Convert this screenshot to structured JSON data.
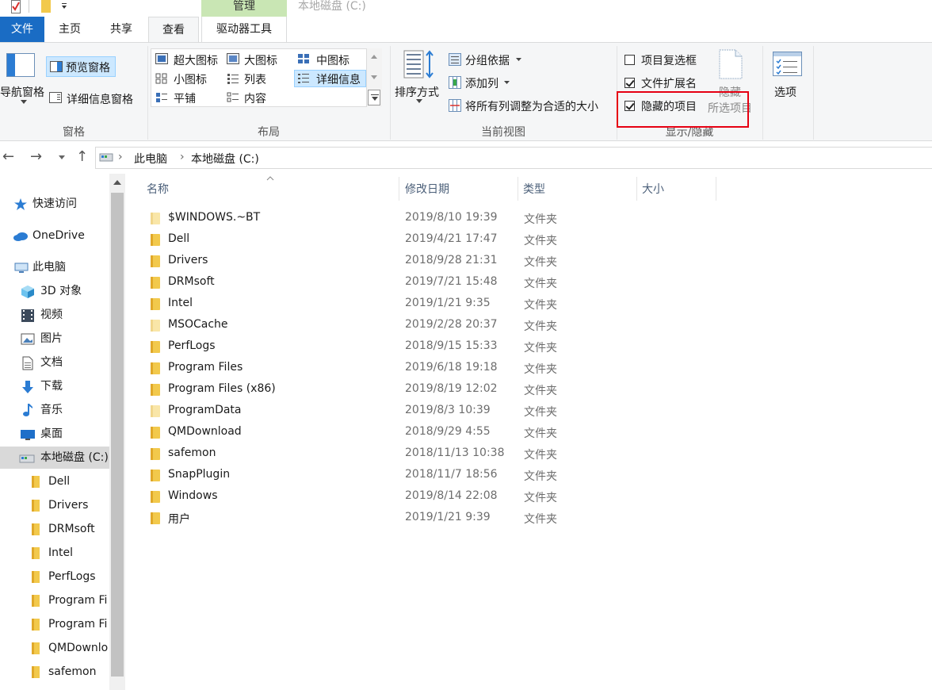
{
  "titlebar": {
    "manage_tab": "管理",
    "window_title": "本地磁盘 (C:)"
  },
  "tabs": {
    "file": "文件",
    "home": "主页",
    "share": "共享",
    "view": "查看",
    "drive_tools": "驱动器工具"
  },
  "ribbon": {
    "panes": {
      "nav_pane": "导航窗格",
      "preview_pane": "预览窗格",
      "details_pane": "详细信息窗格",
      "label": "窗格"
    },
    "layout": {
      "items": [
        "超大图标",
        "大图标",
        "中图标",
        "小图标",
        "列表",
        "详细信息",
        "平铺",
        "内容"
      ],
      "selected": "详细信息",
      "label": "布局"
    },
    "current_view": {
      "sort_by": "排序方式",
      "group_by": "分组依据",
      "add_column": "添加列",
      "fit_columns": "将所有列调整为合适的大小",
      "label": "当前视图"
    },
    "show_hide": {
      "item_checkboxes": "项目复选框",
      "item_checkboxes_checked": false,
      "file_extensions": "文件扩展名",
      "file_extensions_checked": true,
      "hidden_items": "隐藏的项目",
      "hidden_items_checked": true,
      "hide_selected_line1": "隐藏",
      "hide_selected_line2": "所选项目",
      "label": "显示/隐藏"
    },
    "options": "选项",
    "highlight_color": "#e60012",
    "accent_color": "#1a6cc4"
  },
  "address": {
    "crumbs": [
      "此电脑",
      "本地磁盘 (C:)"
    ]
  },
  "nav": {
    "quick_access": "快速访问",
    "onedrive": "OneDrive",
    "this_pc": "此电脑",
    "objects_3d": "3D 对象",
    "videos": "视频",
    "pictures": "图片",
    "documents": "文档",
    "downloads": "下载",
    "music": "音乐",
    "desktop": "桌面",
    "local_disk": "本地磁盘 (C:)",
    "children": [
      "Dell",
      "Drivers",
      "DRMsoft",
      "Intel",
      "PerfLogs",
      "Program Fi",
      "Program Fi",
      "QMDownlo",
      "safemon"
    ]
  },
  "columns": {
    "name": "名称",
    "date": "修改日期",
    "type": "类型",
    "size": "大小"
  },
  "files": [
    {
      "name": "$WINDOWS.~BT",
      "date": "2019/8/10 19:39",
      "type": "文件夹",
      "hidden": true
    },
    {
      "name": "Dell",
      "date": "2019/4/21 17:47",
      "type": "文件夹",
      "hidden": false
    },
    {
      "name": "Drivers",
      "date": "2018/9/28 21:31",
      "type": "文件夹",
      "hidden": false
    },
    {
      "name": "DRMsoft",
      "date": "2019/7/21 15:48",
      "type": "文件夹",
      "hidden": false
    },
    {
      "name": "Intel",
      "date": "2019/1/21 9:35",
      "type": "文件夹",
      "hidden": false
    },
    {
      "name": "MSOCache",
      "date": "2019/2/28 20:37",
      "type": "文件夹",
      "hidden": true
    },
    {
      "name": "PerfLogs",
      "date": "2018/9/15 15:33",
      "type": "文件夹",
      "hidden": false
    },
    {
      "name": "Program Files",
      "date": "2019/6/18 19:18",
      "type": "文件夹",
      "hidden": false
    },
    {
      "name": "Program Files (x86)",
      "date": "2019/8/19 12:02",
      "type": "文件夹",
      "hidden": false
    },
    {
      "name": "ProgramData",
      "date": "2019/8/3 10:39",
      "type": "文件夹",
      "hidden": true
    },
    {
      "name": "QMDownload",
      "date": "2018/9/29 4:55",
      "type": "文件夹",
      "hidden": false
    },
    {
      "name": "safemon",
      "date": "2018/11/13 10:38",
      "type": "文件夹",
      "hidden": false
    },
    {
      "name": "SnapPlugin",
      "date": "2018/11/7 18:56",
      "type": "文件夹",
      "hidden": false
    },
    {
      "name": "Windows",
      "date": "2019/8/14 22:08",
      "type": "文件夹",
      "hidden": false
    },
    {
      "name": "用户",
      "date": "2019/1/21 9:39",
      "type": "文件夹",
      "hidden": false
    }
  ]
}
